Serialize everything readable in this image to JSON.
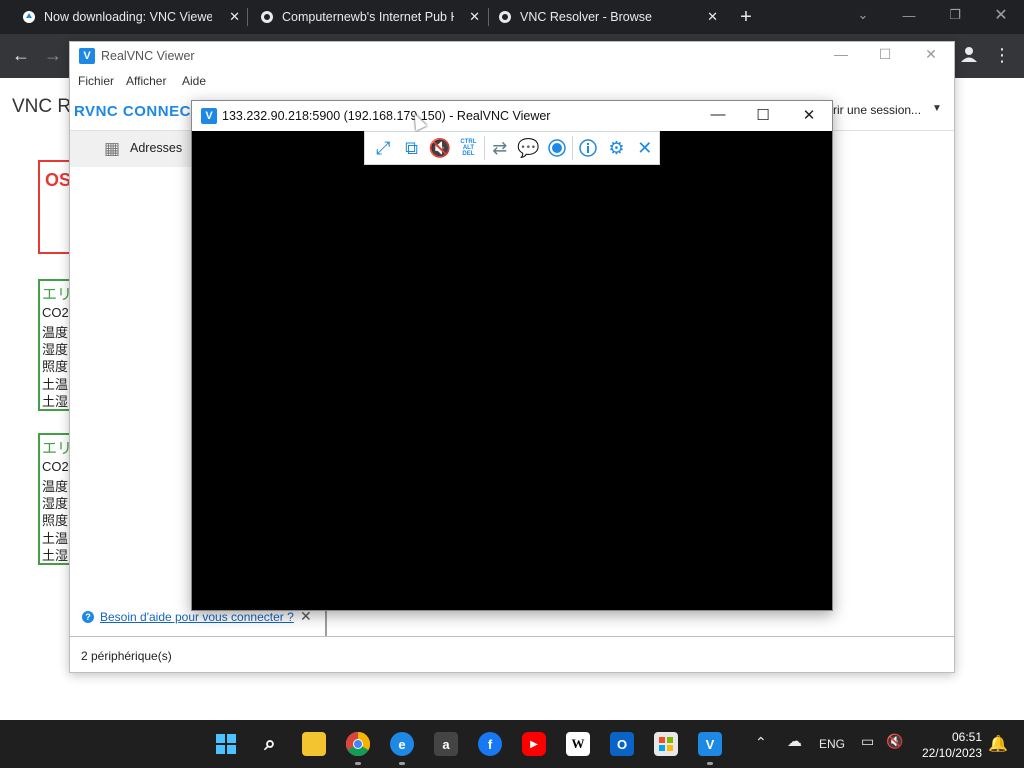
{
  "browser": {
    "tabs": [
      {
        "title": "Now downloading: VNC Viewer",
        "icon": "vnc-icon"
      },
      {
        "title": "Computernewb's Internet Pub H",
        "icon": "computernewb-icon"
      },
      {
        "title": "VNC Resolver - Browse",
        "icon": "computernewb-icon"
      }
    ],
    "new_tab": "+",
    "close_glyph": "✕"
  },
  "page": {
    "title_partial": "VNC R",
    "os_box": "OS",
    "area_blocks": [
      {
        "heading": "エリ",
        "rows": [
          "CO2",
          "温度",
          "湿度",
          "照度",
          "土温",
          "土湿"
        ]
      },
      {
        "heading": "エリ",
        "rows": [
          "CO2",
          "温度",
          "湿度",
          "照度",
          "土温",
          "土湿"
        ]
      }
    ]
  },
  "vnc_main": {
    "title": "RealVNC Viewer",
    "menu": [
      "Fichier",
      "Afficher",
      "Aide"
    ],
    "brand": "RVNC CONNECT",
    "session_field": "vrir une session...",
    "sidebar_item": "Adresses",
    "help_link": "Besoin d'aide pour vous connecter ?",
    "device_count": "2 périphérique(s)"
  },
  "vnc_session": {
    "title": "133.232.90.218:5900 (192.168.179.150) - RealVNC Viewer",
    "toolbar": [
      "fullscreen-icon",
      "scale-icon",
      "audio-muted-icon",
      "ctrl-alt-del-icon",
      "file-transfer-icon",
      "chat-icon",
      "record-icon",
      "info-icon",
      "settings-icon",
      "close-icon"
    ],
    "cad_label": [
      "CTRL",
      "ALT",
      "DEL"
    ]
  },
  "taskbar": {
    "apps": [
      "start-icon",
      "search-icon",
      "file-explorer-icon",
      "chrome-icon",
      "edge-icon",
      "amazon-icon",
      "facebook-icon",
      "youtube-icon",
      "wikipedia-icon",
      "outlook-icon",
      "store-icon",
      "vnc-viewer-icon"
    ],
    "language": "ENG",
    "time": "06:51",
    "date": "22/10/2023"
  },
  "colors": {
    "accent": "#1e88e5",
    "browser_dark": "#202124",
    "taskbar": "#1f1f1f",
    "status_red": "#e53935",
    "status_green": "#43a047"
  }
}
